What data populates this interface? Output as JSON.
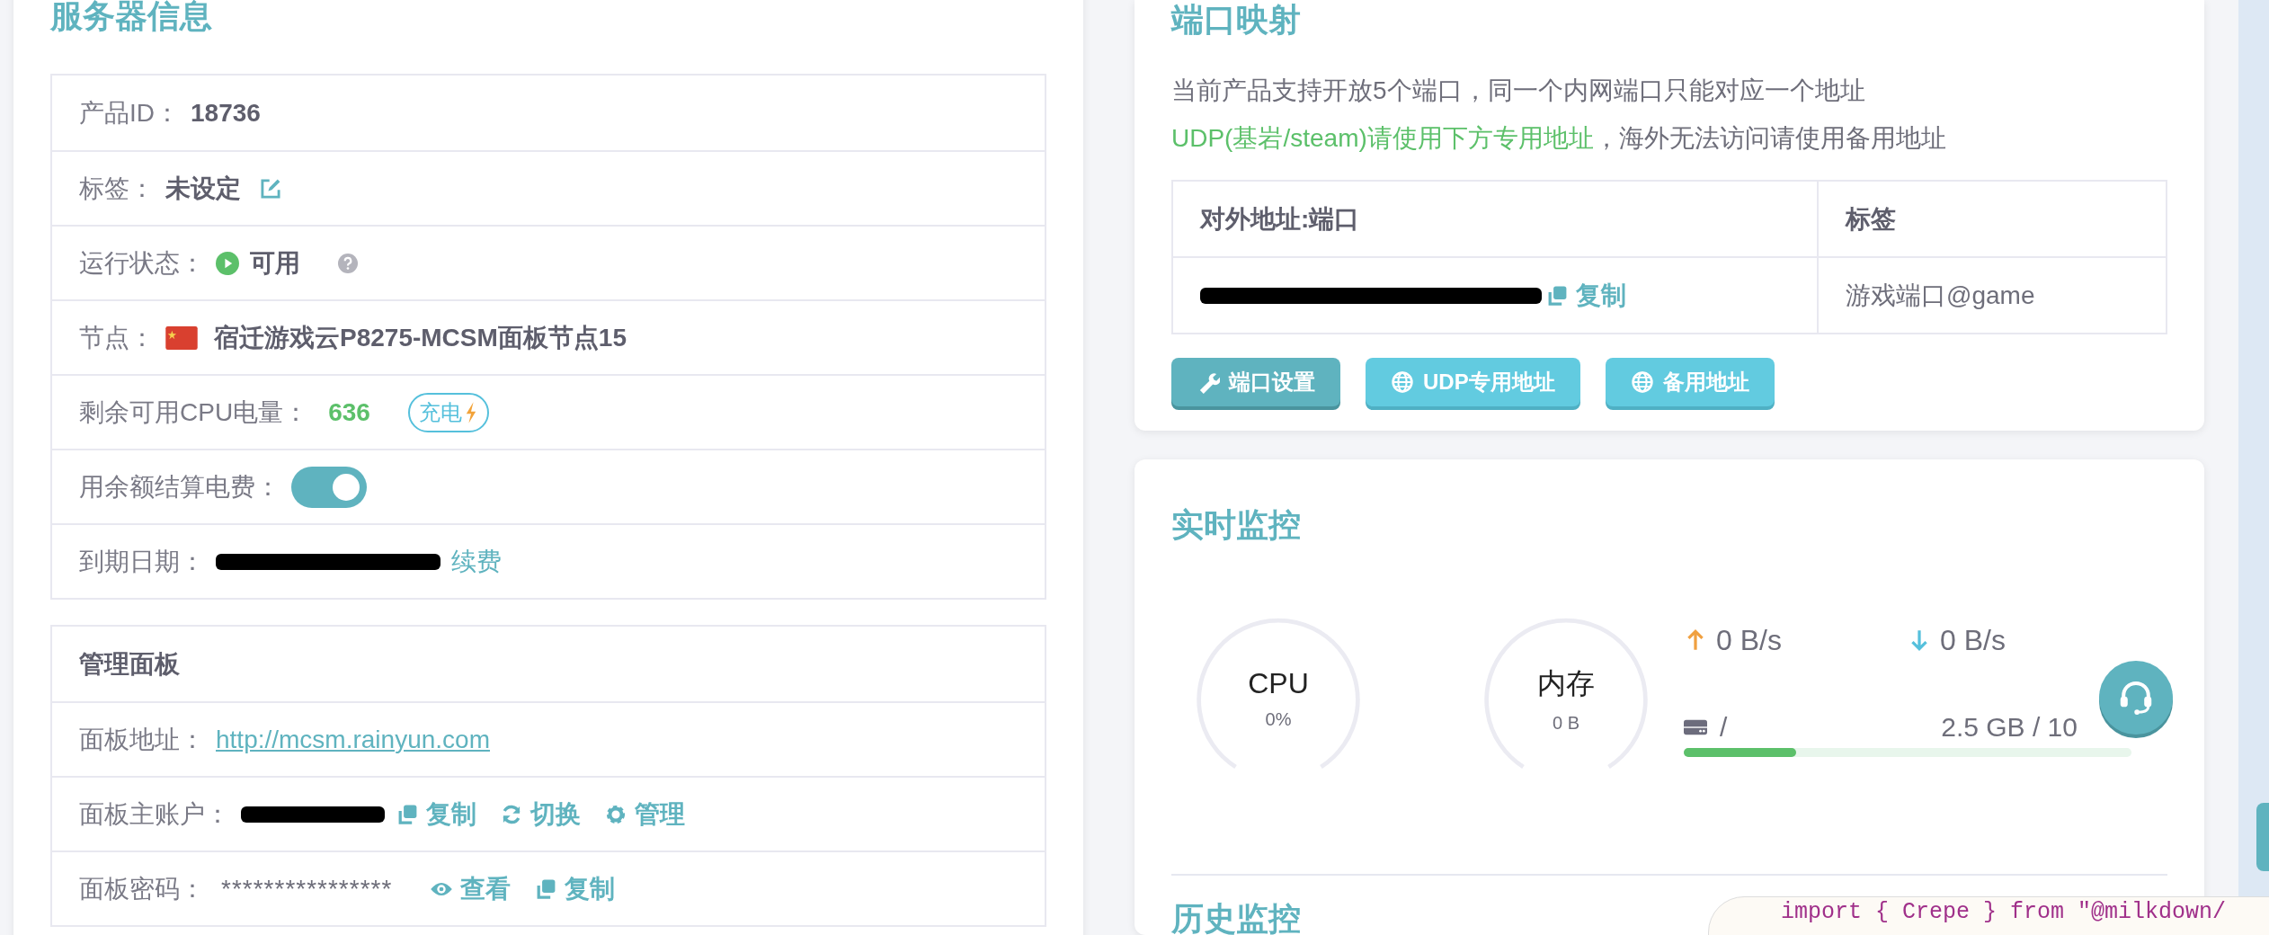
{
  "server_info": {
    "title": "服务器信息",
    "rows": [
      {
        "kind": "text",
        "label": "产品ID：",
        "value": "18736"
      },
      {
        "kind": "tag",
        "label": "标签：",
        "value": "未设定"
      },
      {
        "kind": "status",
        "label": "运行状态：",
        "value": "可用",
        "available": true
      },
      {
        "kind": "node",
        "label": "节点：",
        "value": "宿迁游戏云P8275-MCSM面板节点15"
      },
      {
        "kind": "power",
        "label": "剩余可用CPU电量：",
        "value": "636",
        "button": "充电"
      },
      {
        "kind": "toggle",
        "label": "用余额结算电费：",
        "on": true
      },
      {
        "kind": "expiry",
        "label": "到期日期：",
        "link": "续费"
      }
    ]
  },
  "panel": {
    "title": "管理面板",
    "rows": [
      {
        "kind": "link",
        "label": "面板地址：",
        "link": "http://mcsm.rainyun.com"
      },
      {
        "kind": "account",
        "label": "面板主账户：",
        "actions": [
          {
            "kind": "copy",
            "label": "复制"
          },
          {
            "kind": "switch",
            "label": "切换"
          },
          {
            "kind": "manage",
            "label": "管理"
          }
        ]
      },
      {
        "kind": "password",
        "label": "面板密码：",
        "value": "****************",
        "actions": [
          {
            "kind": "view",
            "label": "查看"
          },
          {
            "kind": "copy",
            "label": "复制"
          }
        ]
      }
    ]
  },
  "port_mapping": {
    "title": "端口映射",
    "notice": "当前产品支持开放5个端口，同一个内网端口只能对应一个地址",
    "notice_green": "UDP(基岩/steam)请使用下方专用地址",
    "notice_rest": "，海外无法访问请使用备用地址",
    "columns": [
      "对外地址:端口",
      "标签"
    ],
    "rows": [
      {
        "copy": "复制",
        "tag": "游戏端口@game"
      }
    ],
    "buttons": [
      {
        "kind": "settings",
        "label": "端口设置"
      },
      {
        "kind": "udp",
        "label": "UDP专用地址"
      },
      {
        "kind": "backup",
        "label": "备用地址"
      }
    ]
  },
  "monitor": {
    "title": "实时监控",
    "gauges": [
      {
        "label": "CPU",
        "value": "0%"
      },
      {
        "label": "内存",
        "value": "0 B"
      }
    ],
    "upload": "0 B/s",
    "download": "0 B/s",
    "disk": {
      "path": "/",
      "usage": "2.5 GB / 10",
      "level": 0.25
    },
    "history_title": "历史监控"
  },
  "code_overlay": {
    "text": "import { Crepe } from \"@milkdown/"
  }
}
